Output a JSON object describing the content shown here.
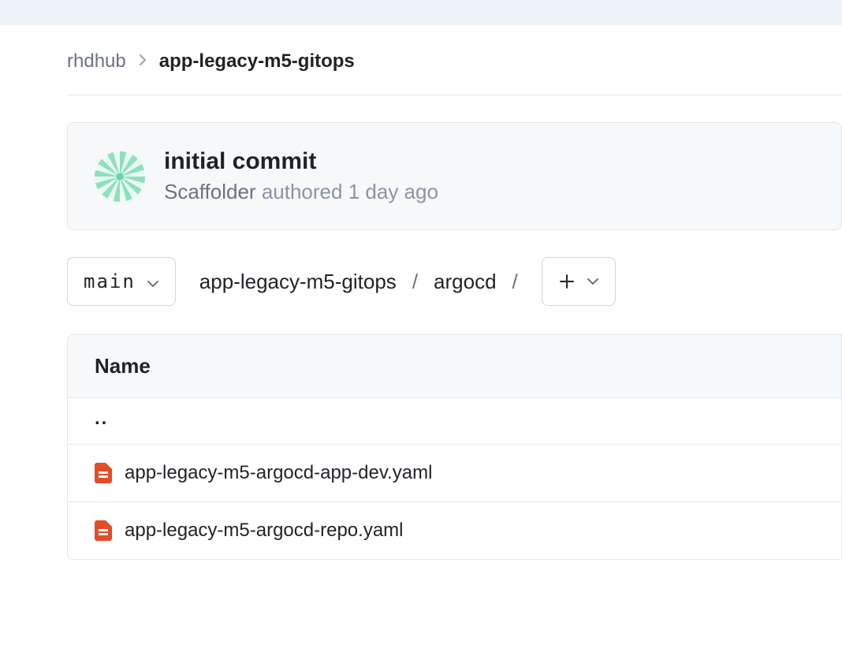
{
  "breadcrumb": {
    "parent": "rhdhub",
    "current": "app-legacy-m5-gitops"
  },
  "commit": {
    "title": "initial commit",
    "author": "Scaffolder",
    "action": "authored",
    "time": "1 day ago"
  },
  "branch": {
    "name": "main"
  },
  "path": {
    "segments": [
      "app-legacy-m5-gitops",
      "argocd"
    ]
  },
  "table": {
    "header": "Name",
    "up": "..",
    "rows": [
      {
        "name": "app-legacy-m5-argocd-app-dev.yaml"
      },
      {
        "name": "app-legacy-m5-argocd-repo.yaml"
      }
    ]
  }
}
